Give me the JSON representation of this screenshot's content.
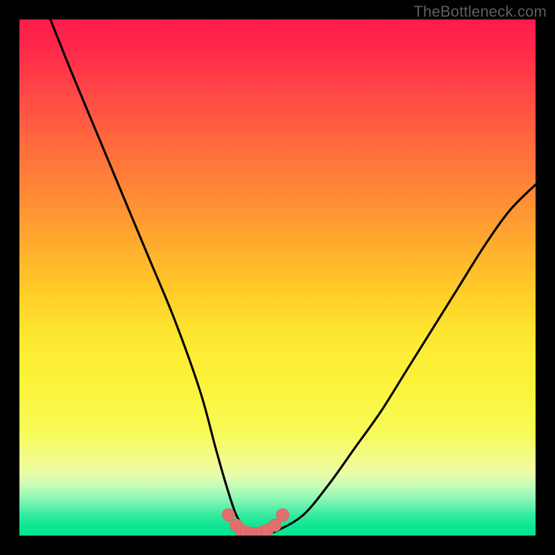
{
  "watermark": {
    "text": "TheBottleneck.com"
  },
  "colors": {
    "frame": "#000000",
    "curve": "#000000",
    "marker": "#e17070",
    "marker_stroke": "#d66565",
    "gradient_stops": [
      "#ff1a4d",
      "#ff4747",
      "#ff8a35",
      "#ffd028",
      "#fbf23a",
      "#e9fca8",
      "#35eba0",
      "#04e58f"
    ]
  },
  "chart_data": {
    "type": "line",
    "title": "",
    "xlabel": "",
    "ylabel": "",
    "xlim": [
      0,
      100
    ],
    "ylim": [
      0,
      100
    ],
    "series": [
      {
        "name": "bottleneck-curve",
        "x": [
          6,
          10,
          15,
          20,
          25,
          30,
          35,
          38,
          40,
          42,
          44,
          45,
          47,
          50,
          55,
          60,
          65,
          70,
          75,
          80,
          85,
          90,
          95,
          100
        ],
        "y": [
          100,
          90,
          78,
          66,
          54,
          42,
          28,
          17,
          10,
          4,
          1,
          0,
          0,
          1,
          4,
          10,
          17,
          24,
          32,
          40,
          48,
          56,
          63,
          68
        ]
      }
    ],
    "markers": {
      "name": "bottom-markers",
      "x": [
        40.5,
        42.0,
        43.0,
        44.0,
        45.0,
        46.0,
        47.0,
        48.0,
        49.5,
        51.0
      ],
      "y": [
        4.0,
        2.0,
        1.0,
        0.6,
        0.4,
        0.4,
        0.6,
        1.0,
        2.0,
        4.0
      ]
    }
  }
}
